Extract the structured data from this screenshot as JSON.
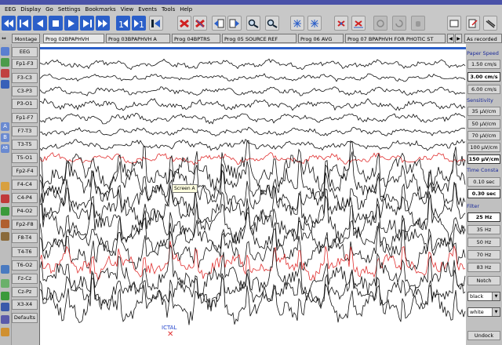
{
  "menu": [
    "EEG",
    "Display",
    "Go",
    "Settings",
    "Bookmarks",
    "View",
    "Events",
    "Tools",
    "Help"
  ],
  "tabs": {
    "montage": "Montage",
    "items": [
      "Prog 02BPAPHVH",
      "Prog 03BPAPHVH A",
      "Prog 04BPTRS",
      "Prog 05 SOURCE REF",
      "Prog 06 AVG",
      "Prog 07 BPAPHVH FOR PHOTIC ST"
    ],
    "as_recorded": "As recorded"
  },
  "channels": [
    "EEG",
    "Fp1-F3",
    "F3-C3",
    "C3-P3",
    "P3-O1",
    "Fp1-F7",
    "F7-T3",
    "T3-T5",
    "T5-O1",
    "Fp2-F4",
    "F4-C4",
    "C4-P4",
    "P4-O2",
    "Fp2-F8",
    "F8-T4",
    "T4-T6",
    "T6-O2",
    "Fz-Cz",
    "Cz-Pz",
    "X3-X4",
    "Defaults"
  ],
  "right": {
    "paper_speed": "Paper Speed",
    "speeds": [
      "1.50 cm/s",
      "3.00 cm/s",
      "6.00 cm/s"
    ],
    "sensitivity": "Sensitivity",
    "sens": [
      "35 µV/cm",
      "50 µV/cm",
      "70 µV/cm",
      "100 µV/cm",
      "150 µV/cm"
    ],
    "time_const": "Time Consta",
    "tcs": [
      "0.10 sec",
      "0.30 sec"
    ],
    "filter": "Filter",
    "filters": [
      "25 Hz",
      "35 Hz",
      "50 Hz",
      "70 Hz",
      "83 Hz"
    ],
    "notch": "Notch",
    "color1": "black",
    "color2": "white",
    "undock": "Undock"
  },
  "annotations": {
    "screen_label": "Screen A",
    "event": "ICTAL"
  },
  "colors": {
    "trace": "#111111",
    "highlight": "#e03030",
    "accent": "#2b5fc9",
    "event": "#2244cc"
  }
}
